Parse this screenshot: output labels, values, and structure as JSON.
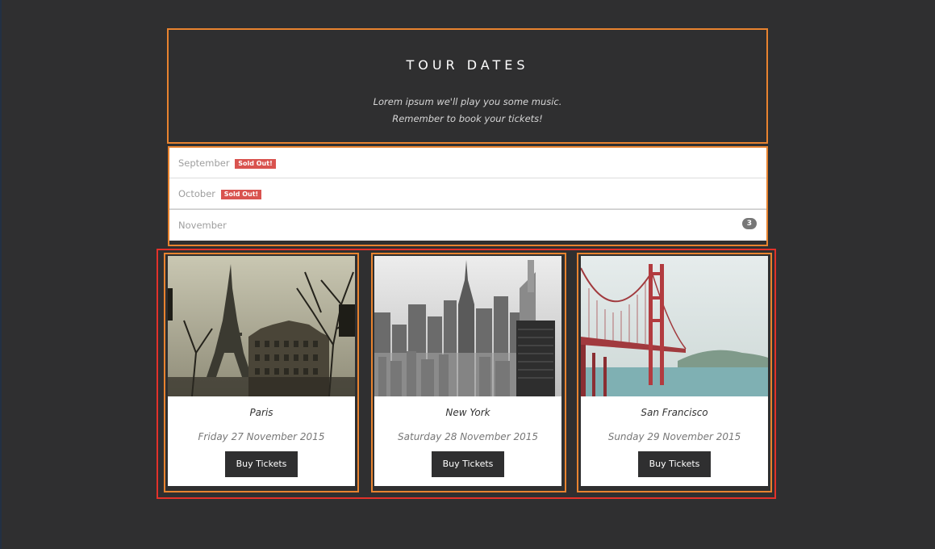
{
  "header": {
    "title": "TOUR DATES",
    "subtitle_line1": "Lorem ipsum we'll play you some music.",
    "subtitle_line2": "Remember to book your tickets!"
  },
  "months": [
    {
      "label": "September",
      "badge": "Sold Out!"
    },
    {
      "label": "October",
      "badge": "Sold Out!"
    },
    {
      "label": "November",
      "count": "3"
    }
  ],
  "cards": [
    {
      "city": "Paris",
      "date": "Friday 27 November 2015",
      "button": "Buy Tickets",
      "image": "eiffel-tower-photo"
    },
    {
      "city": "New York",
      "date": "Saturday 28 November 2015",
      "button": "Buy Tickets",
      "image": "new-york-skyline-photo"
    },
    {
      "city": "San Francisco",
      "date": "Sunday 29 November 2015",
      "button": "Buy Tickets",
      "image": "golden-gate-bridge-photo"
    }
  ],
  "colors": {
    "background": "#2f2f30",
    "highlight_orange": "#e8832f",
    "highlight_red": "#e2322a",
    "sold_out": "#d9534f",
    "badge_gray": "#777777"
  }
}
